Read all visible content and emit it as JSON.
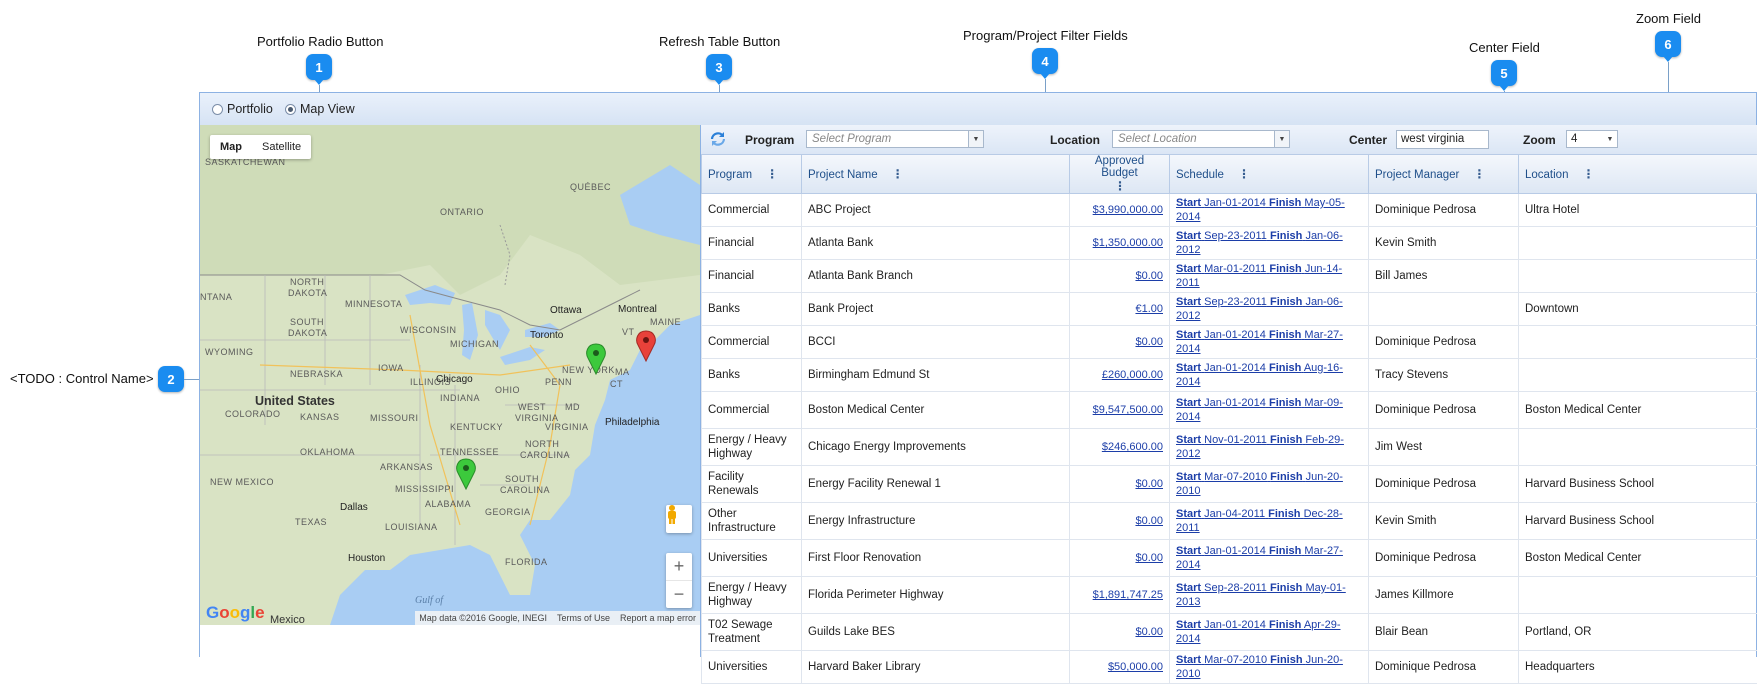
{
  "callouts": [
    {
      "num": "1",
      "label": "Portfolio Radio Button"
    },
    {
      "num": "2",
      "label": "<TODO : Control Name>"
    },
    {
      "num": "3",
      "label": "Refresh Table Button"
    },
    {
      "num": "4",
      "label": "Program/Project Filter Fields"
    },
    {
      "num": "5",
      "label": "Center Field"
    },
    {
      "num": "6",
      "label": "Zoom Field"
    }
  ],
  "view_toggle": {
    "portfolio_label": "Portfolio",
    "mapview_label": "Map View",
    "selected": "Map View"
  },
  "map": {
    "type_buttons": [
      "Map",
      "Satellite"
    ],
    "selected_type": "Map",
    "footer": [
      "Map data ©2016 Google, INEGI",
      "Terms of Use",
      "Report a map error"
    ],
    "logo": "Google",
    "zoom_in": "+",
    "zoom_out": "−",
    "labels": {
      "saskatchewan": "SASKATCHEWAN",
      "ontario": "ONTARIO",
      "quebec": "QUÉBEC",
      "north_dakota": "NORTH\nDAKOTA",
      "minnesota": "MINNESOTA",
      "wisconsin": "WISCONSIN",
      "michigan": "MICHIGAN",
      "maine": "MAINE",
      "vt": "VT",
      "south_dakota": "SOUTH\nDAKOTA",
      "wyoming": "WYOMING",
      "iowa": "IOWA",
      "nebraska": "NEBRASKA",
      "illinois": "ILLINOIS",
      "ohio": "OHIO",
      "indiana": "INDIANA",
      "penn": "PENN",
      "ma": "MA",
      "ct": "CT",
      "united_states": "United States",
      "kansas": "KANSAS",
      "missouri": "MISSOURI",
      "colorado": "COLORADO",
      "west_virginia": "WEST\nVIRGINIA",
      "virginia": "VIRGINIA",
      "kentucky": "KENTUCKY",
      "md": "MD",
      "oklahoma": "OKLAHOMA",
      "tennessee": "TENNESSEE",
      "north_carolina": "NORTH\nCAROLINA",
      "south_carolina": "SOUTH\nCAROLINA",
      "arkansas": "ARKANSAS",
      "new_mexico": "NEW MEXICO",
      "mississippi": "MISSISSIPPI",
      "alabama": "ALABAMA",
      "georgia": "GEORGIA",
      "texas": "TEXAS",
      "louisiana": "LOUISIANA",
      "florida": "FLORIDA",
      "gulf": "Gulf of",
      "mexico": "Mexico",
      "ntana": "NTANA",
      "ottawa": "Ottawa",
      "montreal": "Montreal",
      "toronto": "Toronto",
      "chicago": "Chicago",
      "philadelphia": "Philadelphia",
      "dallas": "Dallas",
      "houston": "Houston",
      "new_york": "NEW YORK"
    }
  },
  "filters": {
    "program_label": "Program",
    "program_placeholder": "Select Program",
    "location_label": "Location",
    "location_placeholder": "Select Location",
    "center_label": "Center",
    "center_value": "west virginia",
    "zoom_label": "Zoom",
    "zoom_value": "4"
  },
  "table": {
    "columns": [
      "Program",
      "Project Name",
      "Approved Budget",
      "Schedule",
      "Project Manager",
      "Location"
    ],
    "start_label": "Start",
    "finish_label": "Finish",
    "rows": [
      {
        "program": "Commercial",
        "name": "ABC Project",
        "budget": "$3,990,000.00",
        "start": "Jan-01-2014",
        "finish": "May-05-2014",
        "manager": "Dominique Pedrosa",
        "location": "Ultra Hotel",
        "tall": false
      },
      {
        "program": "Financial",
        "name": "Atlanta Bank",
        "budget": "$1,350,000.00",
        "start": "Sep-23-2011",
        "finish": "Jan-06-2012",
        "manager": "Kevin Smith",
        "location": "",
        "tall": false
      },
      {
        "program": "Financial",
        "name": "Atlanta Bank Branch",
        "budget": "$0.00",
        "start": "Mar-01-2011",
        "finish": "Jun-14-2011",
        "manager": "Bill James",
        "location": "",
        "tall": false
      },
      {
        "program": "Banks",
        "name": "Bank Project",
        "budget": "€1.00",
        "start": "Sep-23-2011",
        "finish": "Jan-06-2012",
        "manager": "",
        "location": "Downtown",
        "tall": false
      },
      {
        "program": "Commercial",
        "name": "BCCI",
        "budget": "$0.00",
        "start": "Jan-01-2014",
        "finish": "Mar-27-2014",
        "manager": "Dominique Pedrosa",
        "location": "",
        "tall": false
      },
      {
        "program": "Banks",
        "name": "Birmingham Edmund St",
        "budget": "£260,000.00",
        "start": "Jan-01-2014",
        "finish": "Aug-16-2014",
        "manager": "Tracy Stevens",
        "location": "",
        "tall": false
      },
      {
        "program": "Commercial",
        "name": "Boston Medical Center",
        "budget": "$9,547,500.00",
        "start": "Jan-01-2014",
        "finish": "Mar-09-2014",
        "manager": "Dominique Pedrosa",
        "location": "Boston Medical Center",
        "tall": true
      },
      {
        "program": "Energy / Heavy Highway",
        "name": "Chicago Energy Improvements",
        "budget": "$246,600.00",
        "start": "Nov-01-2011",
        "finish": "Feb-29-2012",
        "manager": "Jim West",
        "location": "",
        "tall": true
      },
      {
        "program": "Facility Renewals",
        "name": "Energy Facility Renewal 1",
        "budget": "$0.00",
        "start": "Mar-07-2010",
        "finish": "Jun-20-2010",
        "manager": "Dominique Pedrosa",
        "location": "Harvard Business School",
        "tall": true
      },
      {
        "program": "Other Infrastructure",
        "name": "Energy Infrastructure",
        "budget": "$0.00",
        "start": "Jan-04-2011",
        "finish": "Dec-28-2011",
        "manager": "Kevin Smith",
        "location": "Harvard Business School",
        "tall": true
      },
      {
        "program": "Universities",
        "name": "First Floor Renovation",
        "budget": "$0.00",
        "start": "Jan-01-2014",
        "finish": "Mar-27-2014",
        "manager": "Dominique Pedrosa",
        "location": "Boston Medical Center",
        "tall": true
      },
      {
        "program": "Energy / Heavy Highway",
        "name": "Florida Perimeter Highway",
        "budget": "$1,891,747.25",
        "start": "Sep-28-2011",
        "finish": "May-01-2013",
        "manager": "James Killmore",
        "location": "",
        "tall": true
      },
      {
        "program": "T02 Sewage Treatment",
        "name": "Guilds Lake BES",
        "budget": "$0.00",
        "start": "Jan-01-2014",
        "finish": "Apr-29-2014",
        "manager": "Blair Bean",
        "location": "Portland, OR",
        "tall": true
      },
      {
        "program": "Universities",
        "name": "Harvard Baker Library",
        "budget": "$50,000.00",
        "start": "Mar-07-2010",
        "finish": "Jun-20-2010",
        "manager": "Dominique Pedrosa",
        "location": "Headquarters",
        "tall": false
      }
    ]
  },
  "colors": {
    "accent": "#1a8cf0",
    "header_text": "#1f4f8a",
    "link": "#1c3ea8",
    "pin_green": "#3cc93c",
    "pin_red": "#e8413a"
  }
}
